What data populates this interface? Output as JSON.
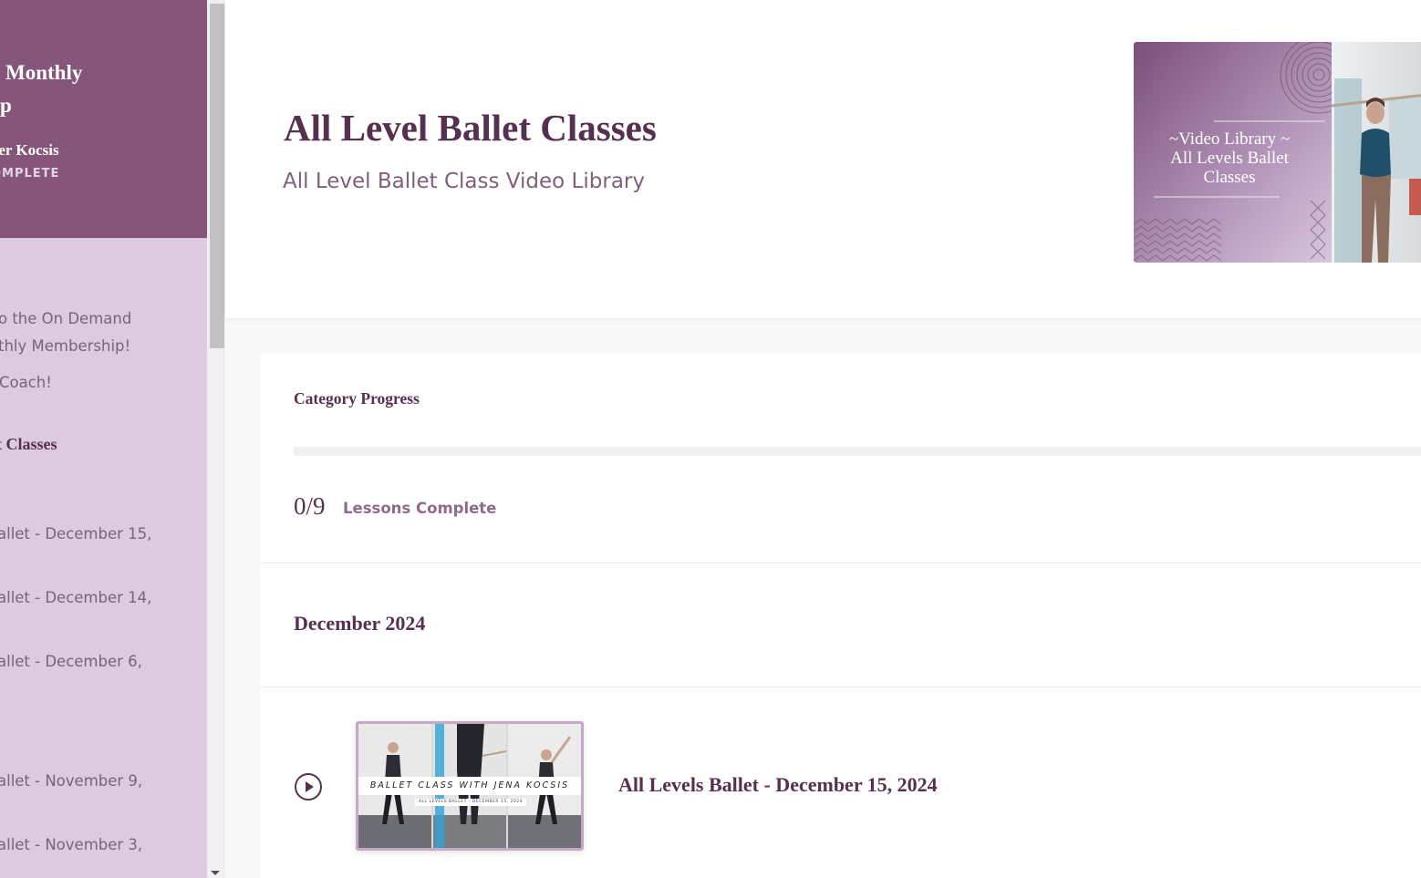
{
  "sidebar": {
    "title_line1": "Monthly",
    "title_line2": "p",
    "author": "ifer Kocsis",
    "status": "OMPLETE",
    "items": [
      {
        "label": "o the On Demand"
      },
      {
        "label": "thly Membership!"
      },
      {
        "label": "Coach!"
      }
    ],
    "section_label": "t Classes",
    "lessons": [
      {
        "label": "allet - December 15,"
      },
      {
        "label": "allet - December 14,"
      },
      {
        "label": "allet - December 6,"
      },
      {
        "label": "allet - November 9,"
      },
      {
        "label": "allet - November 3,"
      }
    ]
  },
  "header": {
    "title": "All Level Ballet Classes",
    "subtitle": "All Level Ballet Class Video Library",
    "cover": {
      "line1": "~Video Library ~",
      "line2": "All Levels Ballet",
      "line3": "Classes"
    }
  },
  "progress": {
    "label": "Category Progress",
    "completed": 0,
    "total": 9,
    "count_text": "0/9",
    "complete_label": "Lessons Complete",
    "fraction": 0
  },
  "month": {
    "heading": "December 2024"
  },
  "lessons": [
    {
      "title": "All Levels Ballet - December 15, 2024",
      "thumb_caption": "BALLET CLASS WITH JENA KOCSIS",
      "thumb_sub": "ALL LEVELS BALLET - DECEMBER 15, 2024"
    }
  ],
  "colors": {
    "brand_plum": "#85567a",
    "sidebar_lilac": "#dccbe0",
    "heading_text": "#55304f"
  }
}
